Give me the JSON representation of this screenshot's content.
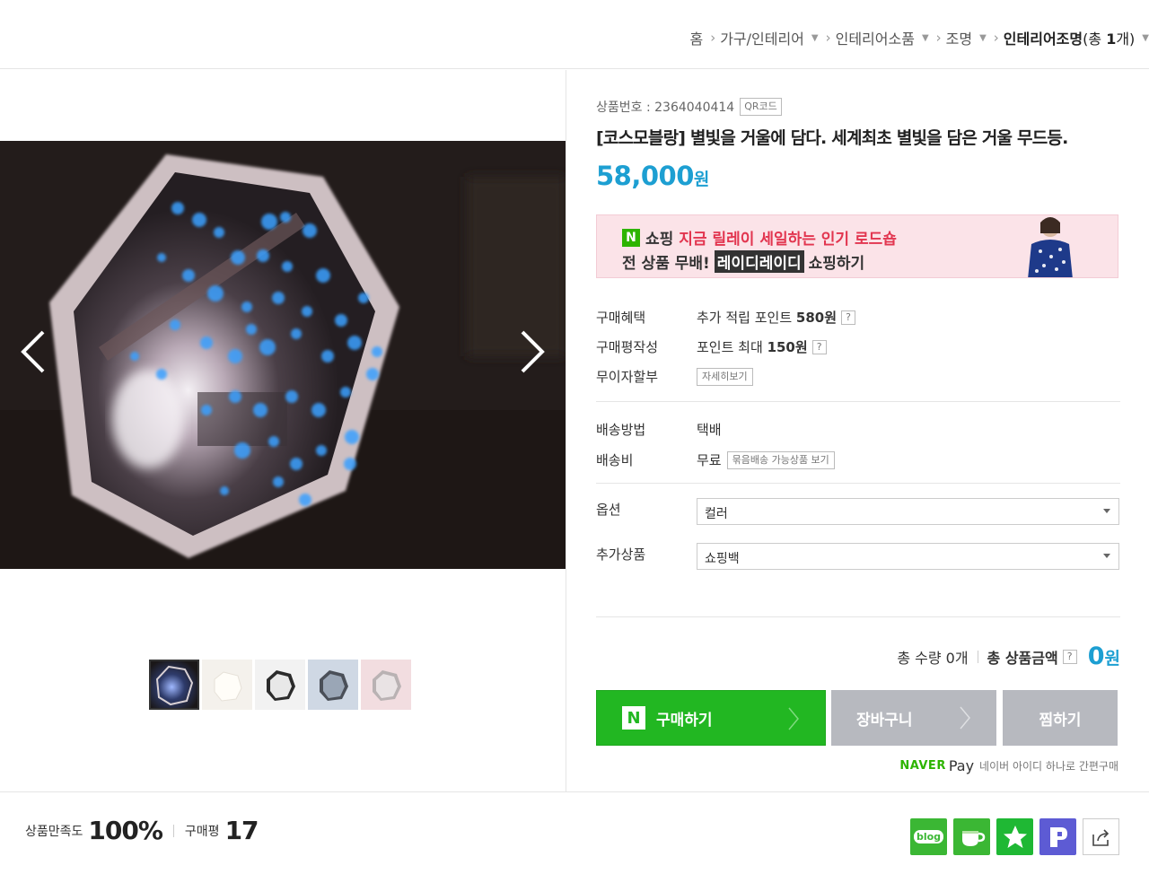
{
  "breadcrumb": {
    "home": "홈",
    "items": [
      "가구/인테리어",
      "인테리어소품",
      "조명"
    ],
    "current": "인테리어조명",
    "count_prefix": "(총 ",
    "count_num": "1",
    "count_suffix": "개)"
  },
  "product": {
    "number_label": "상품번호 : 2364040414",
    "qr_label": "QR코드",
    "title": "[코스모블랑] 별빛을 거울에 담다. 세계최초 별빛을 담은 거울 무드등.",
    "price": "58,000",
    "price_unit": "원"
  },
  "banner": {
    "logo": "N",
    "line1_a": "쇼핑",
    "line1_b": "지금 릴레이 세일하는 인기 로드숍",
    "line2_a": "전 상품 무배!",
    "line2_b": "레이디레이디",
    "line2_c": "쇼핑하기"
  },
  "info": {
    "benefit_key": "구매혜택",
    "benefit_val": "추가 적립 포인트",
    "benefit_pts": "580원",
    "review_key": "구매평작성",
    "review_val": "포인트 최대",
    "review_pts": "150원",
    "installment_key": "무이자할부",
    "installment_btn": "자세히보기",
    "ship_method_key": "배송방법",
    "ship_method_val": "택배",
    "ship_fee_key": "배송비",
    "ship_fee_val": "무료",
    "ship_bundle_btn": "묶음배송 가능상품 보기",
    "qmark": "?"
  },
  "options": {
    "option_label": "옵션",
    "option_value": "컬러",
    "extra_label": "추가상품",
    "extra_value": "쇼핑백"
  },
  "total": {
    "qty_label": "총 수량 0개",
    "amount_label": "총 상품금액",
    "amount": "0",
    "unit": "원"
  },
  "buttons": {
    "buy_logo": "N",
    "buy": "구매하기",
    "cart": "장바구니",
    "wish": "찜하기"
  },
  "npay": {
    "naver": "NAVER",
    "pay": "Pay",
    "desc": "네이버 아이디 하나로 간편구매"
  },
  "footer": {
    "satisfaction_label": "상품만족도",
    "satisfaction_value": "100%",
    "review_label": "구매평",
    "review_count": "17",
    "blog_label": "blog"
  },
  "colors": {
    "accent": "#1d9fd2",
    "buy_green": "#22b722",
    "gray_button": "#b7b9bf",
    "banner_bg": "#fbe3e8",
    "banner_red": "#e2354f"
  },
  "icons": [
    "chevron-left-icon",
    "chevron-right-icon",
    "blog-icon",
    "cafe-icon",
    "star-icon",
    "post-icon",
    "share-icon"
  ]
}
